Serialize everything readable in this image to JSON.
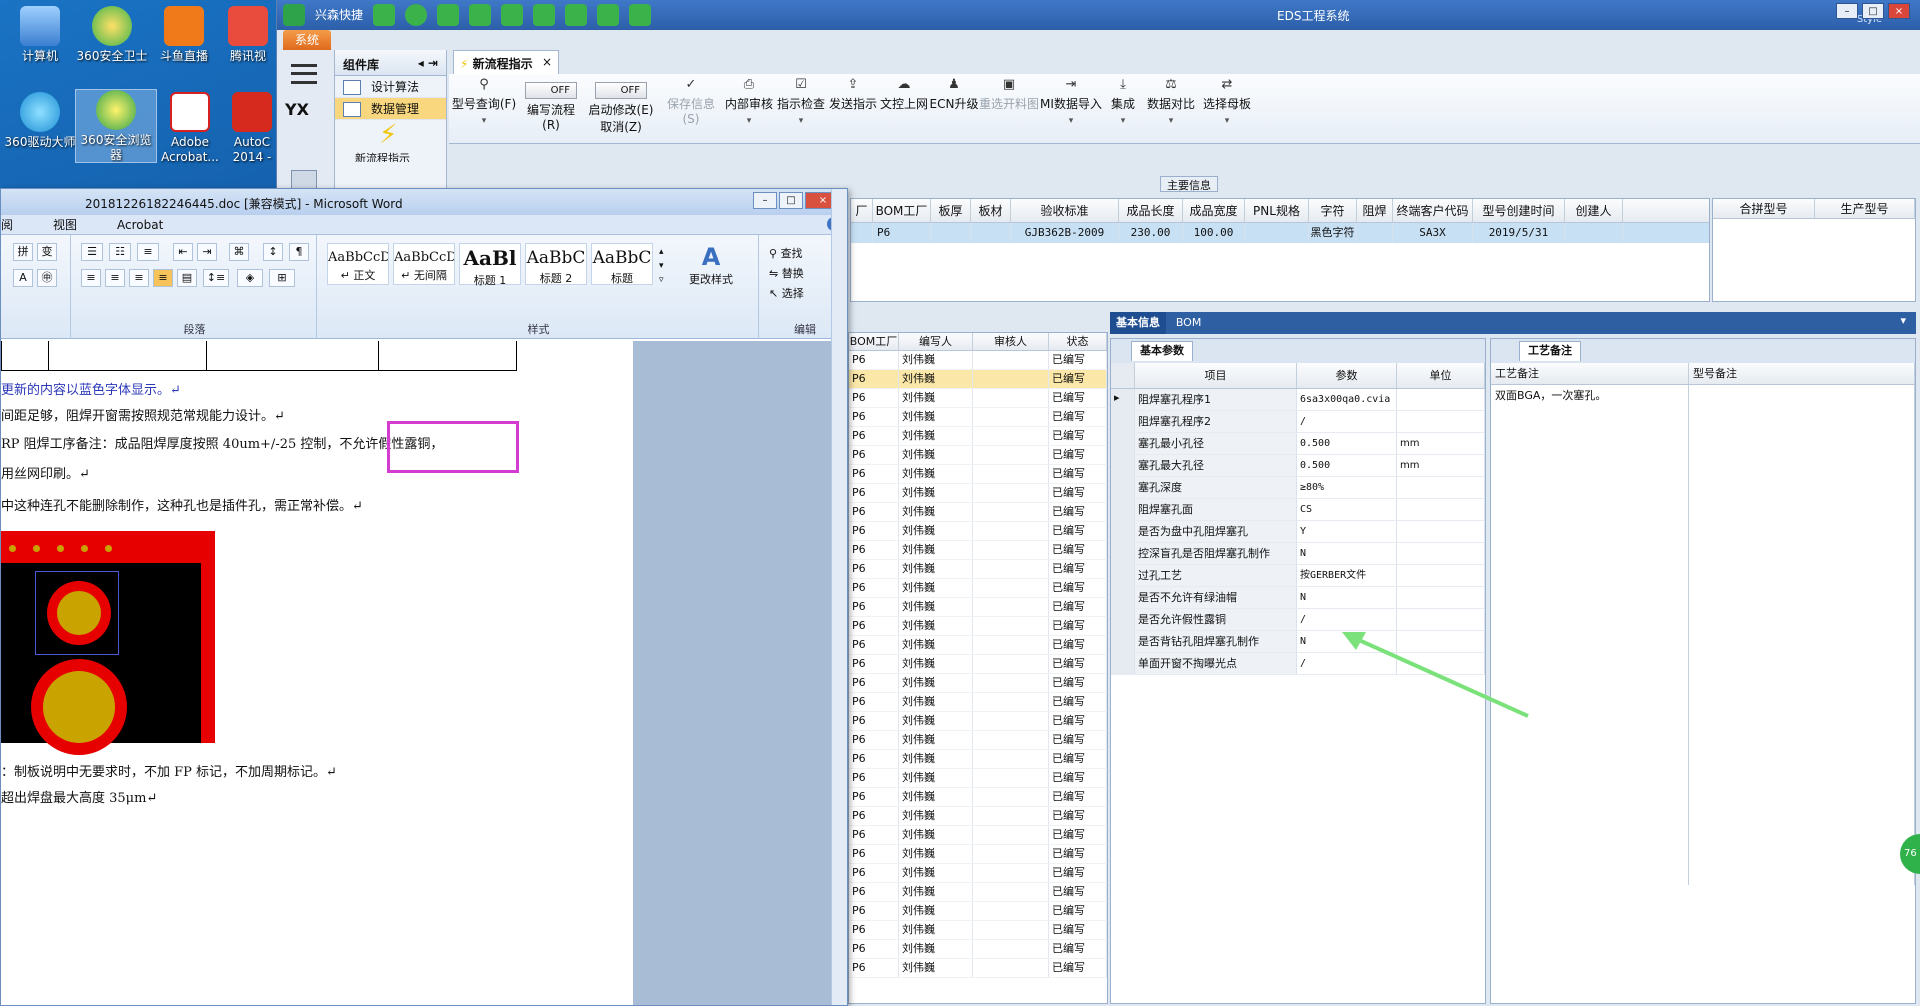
{
  "desktop": {
    "icons": [
      {
        "label": "计算机"
      },
      {
        "label": "360安全卫士"
      },
      {
        "label": "斗鱼直播"
      },
      {
        "label": "腾讯视"
      },
      {
        "label": "360驱动大师"
      },
      {
        "label": "360安全浏览器"
      },
      {
        "label": "Adobe Acrobat..."
      },
      {
        "label": "AutoC 2014 -"
      }
    ]
  },
  "eds": {
    "title": "EDS工程系统",
    "quick_access_label": "兴森快捷",
    "style_label": "Style",
    "system_tab": "系统",
    "window_buttons": {
      "min": "–",
      "max": "□",
      "close": "×"
    },
    "sidebar": {
      "icon_label": "YX",
      "component_header": "组件库",
      "items": [
        {
          "label": "设计算法"
        },
        {
          "label": "数据管理"
        }
      ],
      "flow_label": "新流程指示"
    },
    "main_tab": {
      "label": "新流程指示",
      "close": "×"
    },
    "toolbar": {
      "buttons": [
        {
          "label": "型号查询(F)",
          "icon": "search-icon",
          "dropdown": "▾"
        },
        {
          "label": "编写流程(R)",
          "toggle": "OFF"
        },
        {
          "label": "启动修改(E)",
          "sublabel": "取消(Z)",
          "toggle": "OFF"
        },
        {
          "label": "保存信息(S)",
          "icon": "check-icon"
        },
        {
          "label": "内部审核",
          "icon": "print-icon",
          "dropdown": "▾"
        },
        {
          "label": "指示检查",
          "icon": "checkbox-icon",
          "dropdown": "▾"
        },
        {
          "label": "发送指示",
          "icon": "upload-icon"
        },
        {
          "label": "文控上网",
          "icon": "cloud-icon"
        },
        {
          "label": "ECN升级",
          "icon": "people-icon"
        },
        {
          "label": "重选开料图",
          "icon": "image-icon"
        },
        {
          "label": "MI数据导入",
          "icon": "import-icon",
          "dropdown": "▾"
        },
        {
          "label": "集成",
          "icon": "download-icon",
          "dropdown": "▾"
        },
        {
          "label": "数据对比",
          "icon": "compare-icon",
          "dropdown": "▾"
        },
        {
          "label": "选择母板",
          "icon": "shuffle-icon",
          "dropdown": "▾"
        }
      ]
    },
    "main_info": {
      "section_title": "主要信息",
      "columns": [
        "厂",
        "BOM工厂",
        "板厚",
        "板材",
        "验收标准",
        "成品长度",
        "成品宽度",
        "PNL规格",
        "字符",
        "阻焊",
        "终端客户代码",
        "型号创建时间",
        "创建人"
      ],
      "row": [
        "",
        "P6",
        "",
        "",
        "GJB362B-2009",
        "230.00",
        "100.00",
        "",
        "黑色字符",
        "",
        "SA3X",
        "2019/5/31",
        ""
      ],
      "right_columns": [
        "合拼型号",
        "生产型号"
      ]
    },
    "list": {
      "columns": [
        "BOM工厂",
        "编写人",
        "审核人",
        "状态"
      ],
      "rows": [
        [
          "P6",
          "刘伟巍",
          "",
          "已编写"
        ],
        [
          "P6",
          "刘伟巍",
          "",
          "已编写"
        ],
        [
          "P6",
          "刘伟巍",
          "",
          "已编写"
        ],
        [
          "P6",
          "刘伟巍",
          "",
          "已编写"
        ],
        [
          "P6",
          "刘伟巍",
          "",
          "已编写"
        ],
        [
          "P6",
          "刘伟巍",
          "",
          "已编写"
        ],
        [
          "P6",
          "刘伟巍",
          "",
          "已编写"
        ],
        [
          "P6",
          "刘伟巍",
          "",
          "已编写"
        ],
        [
          "P6",
          "刘伟巍",
          "",
          "已编写"
        ],
        [
          "P6",
          "刘伟巍",
          "",
          "已编写"
        ],
        [
          "P6",
          "刘伟巍",
          "",
          "已编写"
        ],
        [
          "P6",
          "刘伟巍",
          "",
          "已编写"
        ],
        [
          "P6",
          "刘伟巍",
          "",
          "已编写"
        ],
        [
          "P6",
          "刘伟巍",
          "",
          "已编写"
        ],
        [
          "P6",
          "刘伟巍",
          "",
          "已编写"
        ],
        [
          "P6",
          "刘伟巍",
          "",
          "已编写"
        ],
        [
          "P6",
          "刘伟巍",
          "",
          "已编写"
        ],
        [
          "P6",
          "刘伟巍",
          "",
          "已编写"
        ],
        [
          "P6",
          "刘伟巍",
          "",
          "已编写"
        ],
        [
          "P6",
          "刘伟巍",
          "",
          "已编写"
        ],
        [
          "P6",
          "刘伟巍",
          "",
          "已编写"
        ],
        [
          "P6",
          "刘伟巍",
          "",
          "已编写"
        ],
        [
          "P6",
          "刘伟巍",
          "",
          "已编写"
        ],
        [
          "P6",
          "刘伟巍",
          "",
          "已编写"
        ],
        [
          "P6",
          "刘伟巍",
          "",
          "已编写"
        ],
        [
          "P6",
          "刘伟巍",
          "",
          "已编写"
        ],
        [
          "P6",
          "刘伟巍",
          "",
          "已编写"
        ],
        [
          "P6",
          "刘伟巍",
          "",
          "已编写"
        ],
        [
          "P6",
          "刘伟巍",
          "",
          "已编写"
        ],
        [
          "P6",
          "刘伟巍",
          "",
          "已编写"
        ],
        [
          "P6",
          "刘伟巍",
          "",
          "已编写"
        ],
        [
          "P6",
          "刘伟巍",
          "",
          "已编写"
        ],
        [
          "P6",
          "刘伟巍",
          "",
          "已编写"
        ]
      ]
    },
    "info_tabs": [
      "基本信息",
      "BOM"
    ],
    "params": {
      "subtab": "基本参数",
      "columns": [
        "项目",
        "参数",
        "单位"
      ],
      "rows": [
        [
          "阻焊塞孔程序1",
          "6sa3x00qa0.cvia",
          ""
        ],
        [
          "阻焊塞孔程序2",
          "/",
          ""
        ],
        [
          "塞孔最小孔径",
          "0.500",
          "mm"
        ],
        [
          "塞孔最大孔径",
          "0.500",
          "mm"
        ],
        [
          "塞孔深度",
          "≥80%",
          ""
        ],
        [
          "阻焊塞孔面",
          "CS",
          ""
        ],
        [
          "是否为盘中孔阻焊塞孔",
          "Y",
          ""
        ],
        [
          "控深盲孔是否阻焊塞孔制作",
          "N",
          ""
        ],
        [
          "过孔工艺",
          "按GERBER文件",
          ""
        ],
        [
          "是否不允许有绿油帽",
          "N",
          ""
        ],
        [
          "是否允许假性露铜",
          "/",
          ""
        ],
        [
          "是否背钻孔阻焊塞孔制作",
          "N",
          ""
        ],
        [
          "单面开窗不掏曝光点",
          "/",
          ""
        ]
      ]
    },
    "process": {
      "subtab": "工艺备注",
      "columns": [
        "工艺备注",
        "型号备注"
      ],
      "note": "双面BGA，一次塞孔。"
    },
    "badge": "76"
  },
  "word": {
    "title": "20181226182246445.doc [兼容模式] - Microsoft Word",
    "menu": [
      "阅",
      "视图",
      "Acrobat"
    ],
    "help": "?",
    "groups": {
      "paragraph": "段落",
      "styles": "样式",
      "edit": "编辑"
    },
    "styles": [
      {
        "sample": "AaBbCcDc",
        "name": "↵ 正文"
      },
      {
        "sample": "AaBbCcDc",
        "name": "↵ 无间隔"
      },
      {
        "sample": "AaBl",
        "name": "标题 1"
      },
      {
        "sample": "AaBbC",
        "name": "标题 2"
      },
      {
        "sample": "AaBbC",
        "name": "标题"
      }
    ],
    "change_style": "更改样式",
    "edit": [
      "查找",
      "替换",
      "选择"
    ],
    "doc_lines": [
      {
        "text": "更新的内容以蓝色字体显示。↵",
        "blue": true
      },
      {
        "text": "间距足够，阻焊开窗需按照规范常规能力设计。↵",
        "blue": false
      },
      {
        "text": "RP 阻焊工序备注：成品阻焊厚度按照 40um+/-25 控制，不允许假性露铜，",
        "blue": false
      },
      {
        "text": "用丝网印刷。↵",
        "blue": false
      },
      {
        "text": "中这种连孔不能删除制作，这种孔也是插件孔，需正常补偿。↵",
        "blue": false
      },
      {
        "text": "：制板说明中无要求时，不加 FP 标记，不加周期标记。↵",
        "blue": false
      },
      {
        "text": "超出焊盘最大高度 35μm↵",
        "blue": false
      }
    ]
  }
}
